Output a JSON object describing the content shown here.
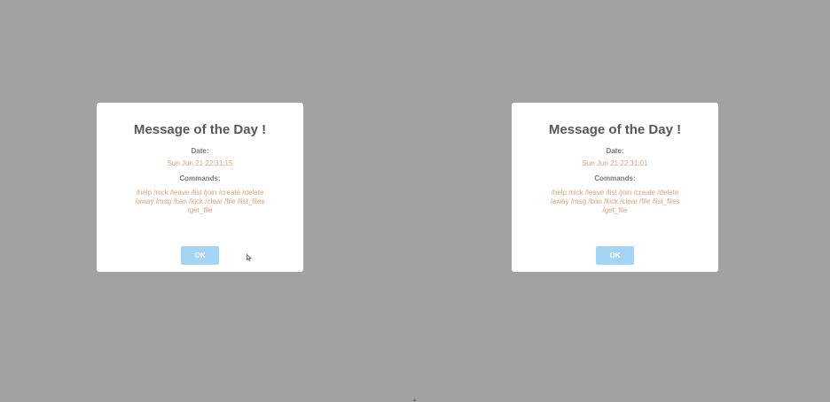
{
  "dialogs": [
    {
      "title": "Message of the Day !",
      "date_label": "Date:",
      "date_value": "Sun Jun 21 22:31:15",
      "commands_label": "Commands:",
      "commands_value": "/help /nick /leave /list /join /create /delete /away /msg /ban /kick /clear /file /list_files /get_file",
      "ok_label": "OK"
    },
    {
      "title": "Message of the Day !",
      "date_label": "Date:",
      "date_value": "Sun Jun 21 22:31:01",
      "commands_label": "Commands:",
      "commands_value": "/help /nick /leave /list /join /create /delete /away /msg /ban /kick /clear /file /list_files /get_file",
      "ok_label": "OK"
    }
  ],
  "colors": {
    "backdrop": "#a2a2a2",
    "title": "#575757",
    "label": "#797979",
    "value": "#d9a27a",
    "ok_button": "#a5d5f5"
  },
  "icons": {
    "cursor": "mouse-cursor-icon"
  }
}
